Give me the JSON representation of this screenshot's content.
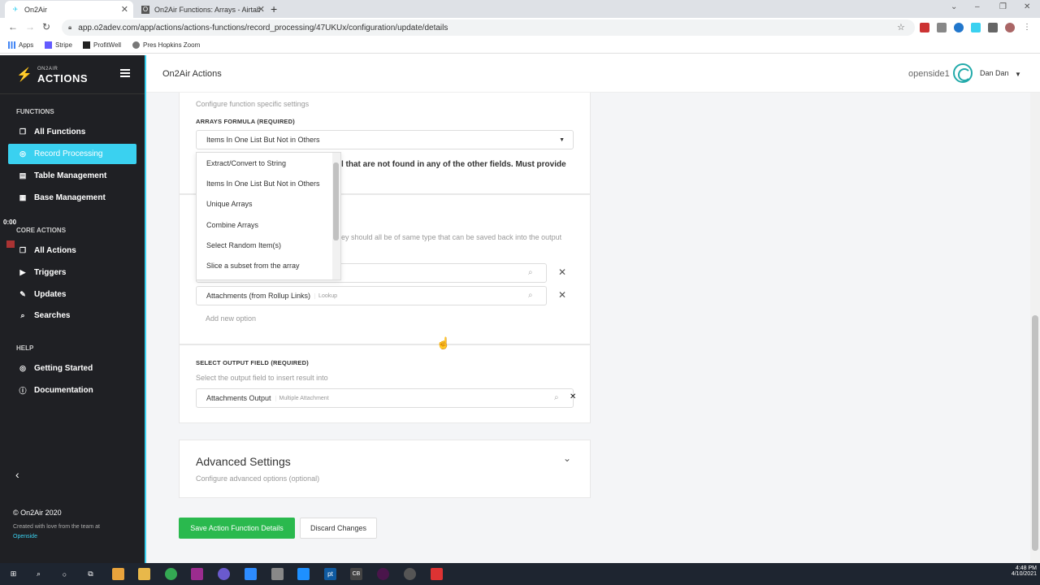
{
  "browser": {
    "tabs": [
      {
        "title": "On2Air",
        "active": true
      },
      {
        "title": "On2Air Functions: Arrays - Airtab",
        "active": false
      }
    ],
    "url": "app.o2adev.com/app/actions/actions-functions/record_processing/47UKUx/configuration/update/details",
    "bookmarks": [
      "Apps",
      "Stripe",
      "ProfitWell",
      "Pres Hopkins Zoom"
    ]
  },
  "sidebar": {
    "brand_small": "ON2AIR",
    "brand_big": "ACTIONS",
    "functions_title": "FUNCTIONS",
    "functions": [
      {
        "label": "All Functions",
        "icon": "copy-icon"
      },
      {
        "label": "Record Processing",
        "icon": "target-icon",
        "active": true
      },
      {
        "label": "Table Management",
        "icon": "table-icon"
      },
      {
        "label": "Base Management",
        "icon": "database-icon"
      }
    ],
    "core_title": "CORE ACTIONS",
    "core": [
      {
        "label": "All Actions",
        "icon": "copy-icon"
      },
      {
        "label": "Triggers",
        "icon": "play-icon"
      },
      {
        "label": "Updates",
        "icon": "edit-icon"
      },
      {
        "label": "Searches",
        "icon": "search-icon"
      }
    ],
    "help_title": "HELP",
    "help": [
      {
        "label": "Getting Started",
        "icon": "target-icon"
      },
      {
        "label": "Documentation",
        "icon": "info-icon"
      }
    ],
    "timer": "0:00",
    "footer_copyright": "© On2Air 2020",
    "footer_love": "Created with love from the team at",
    "footer_link": "Openside"
  },
  "header": {
    "title": "On2Air Actions",
    "workspace": "openside1",
    "user": "Dan Dan"
  },
  "form": {
    "function_settings_desc": "Configure function specific settings",
    "arrays_formula_label": "ARRAYS FORMULA (REQUIRED)",
    "arrays_formula_value": "Items In One List But Not in Others",
    "formula_help_visible": "l that are not found in any of the other fields. Must provide",
    "input_help_visible": "ey should all be of same type that can be saved back into the output",
    "input_fields": [
      {
        "name": "",
        "type": ""
      },
      {
        "name": "Attachments (from Rollup Links)",
        "type": "Lookup"
      }
    ],
    "add_option": "Add new option",
    "output_label": "SELECT OUTPUT FIELD (REQUIRED)",
    "output_desc": "Select the output field to insert result into",
    "output_value": "Attachments Output",
    "output_type": "Multiple Attachment",
    "advanced_title": "Advanced Settings",
    "advanced_desc": "Configure advanced options (optional)",
    "save_label": "Save Action Function Details",
    "discard_label": "Discard Changes"
  },
  "dropdown": {
    "options": [
      "Extract/Convert to String",
      "Items In One List But Not in Others",
      "Unique Arrays",
      "Combine Arrays",
      "Select Random Item(s)",
      "Slice a subset from the array"
    ]
  },
  "taskbar": {
    "time": "4:48 PM",
    "date": "4/10/2021"
  },
  "colors": {
    "accent": "#3ad1f0",
    "sidebar_bg": "#1f2024",
    "save_green": "#2ab94e"
  }
}
